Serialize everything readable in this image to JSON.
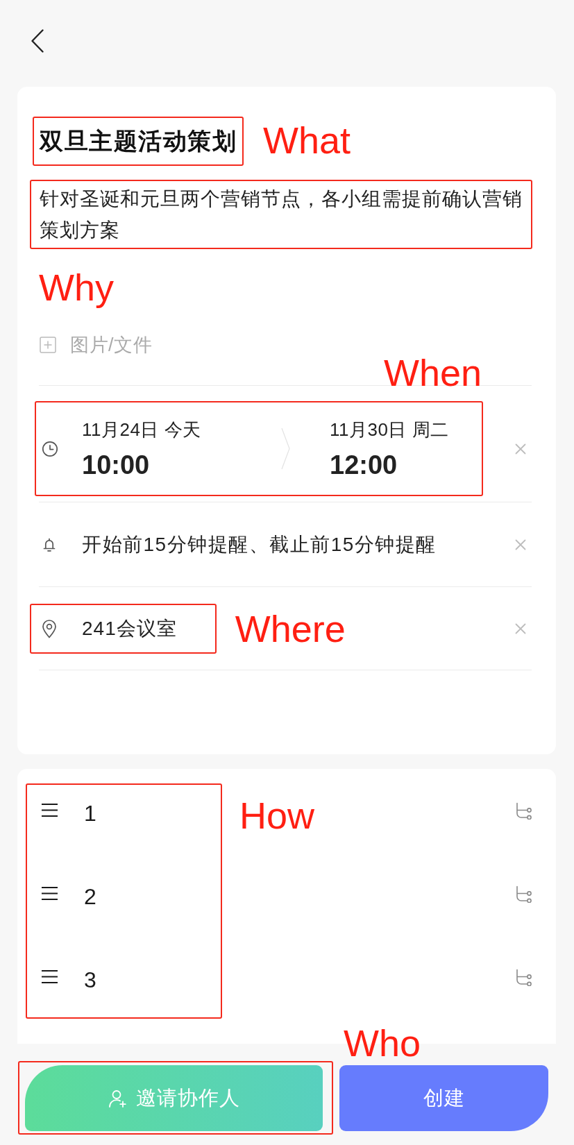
{
  "title": {
    "text": "双旦主题活动策划",
    "annotation": "What"
  },
  "description": {
    "text": "针对圣诞和元旦两个营销节点，各小组需提前确认营销策划方案",
    "annotation": "Why"
  },
  "attachment": {
    "label": "图片/文件"
  },
  "schedule": {
    "annotation": "When",
    "start": {
      "date": "11月24日 今天",
      "time": "10:00"
    },
    "end": {
      "date": "11月30日 周二",
      "time": "12:00"
    }
  },
  "reminder": {
    "text": "开始前15分钟提醒、截止前15分钟提醒"
  },
  "location": {
    "text": "241会议室",
    "annotation": "Where"
  },
  "steps": {
    "annotation": "How",
    "items": [
      {
        "label": "1"
      },
      {
        "label": "2"
      },
      {
        "label": "3"
      }
    ]
  },
  "actions": {
    "annotation": "Who",
    "invite": "邀请协作人",
    "create": "创建"
  }
}
